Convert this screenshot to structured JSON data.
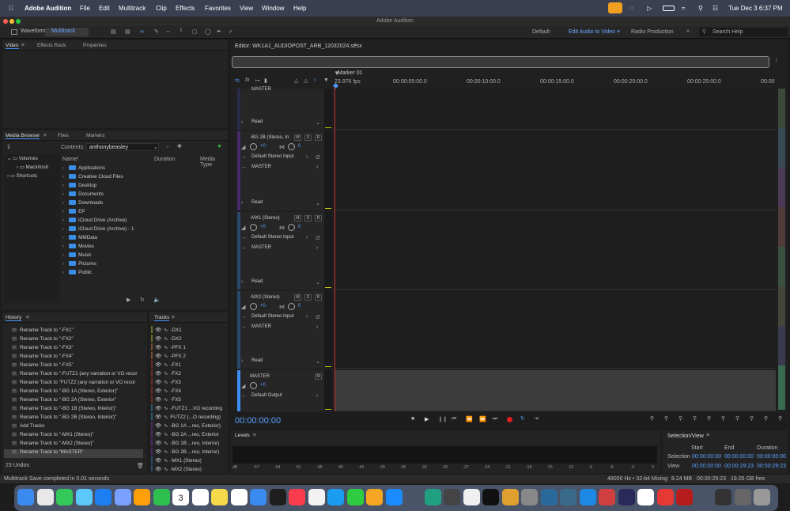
{
  "menubar": {
    "app": "Adobe Audition",
    "items": [
      "File",
      "Edit",
      "Multitrack",
      "Clip",
      "Effects",
      "Favorites",
      "View",
      "Window",
      "Help"
    ],
    "clock": "Tue Dec 3  6:37 PM"
  },
  "window": {
    "title": "Adobe Audition"
  },
  "toolbar": {
    "waveform": "Waveform",
    "multitrack": "Multitrack",
    "workspaces": [
      "Default",
      "Edit Audio to Video",
      "Radio Production"
    ],
    "search_placeholder": "Search Help"
  },
  "left_top_tabs": [
    "Video",
    "Effects Rack",
    "Properties"
  ],
  "media_browser": {
    "tabs": [
      "Media Browser",
      "Files",
      "Markers"
    ],
    "contents_label": "Contents:",
    "contents_value": "anthonybeasley",
    "tree": [
      "Volumes",
      "Macintosh",
      "Shortcuts"
    ],
    "columns": [
      "Name",
      "Duration",
      "Media Type"
    ],
    "items": [
      "Applications",
      "Creative Cloud Files",
      "Desktop",
      "Documents",
      "Downloads",
      "EP",
      "iCloud Drive (Archive)",
      "iCloud Drive (Archive) - 1",
      "MMData",
      "Movies",
      "Music",
      "Pictures",
      "Public"
    ]
  },
  "history": {
    "title": "History",
    "items": [
      "Rename Track to \"-FX1\"",
      "Rename Track to \"-FX2\"",
      "Rename Track to \"-FX3\"",
      "Rename Track to \"-FX4\"",
      "Rename Track to \"-FX5\"",
      "Rename Track to \"-FUTZ1 (any narration or VO recor",
      "Rename Track to \"FUTZ2 (any narration or VO recor",
      "Rename Track to \"-BG 1A (Stereo, Exterior)\"",
      "Rename Track to \"-BG 2A (Stereo, Exterior\"",
      "Rename Track to \"-BG 1B (Stereo, Interior)\"",
      "Rename Track to \"-BG 2B (Stereo, Interior)\"",
      "Add Tracks",
      "Rename Track to \"-MX1 (Stereo)\"",
      "Rename Track to \"-MX2 (Stereo)\"",
      "Rename Track to \"MASTER\""
    ],
    "undos": "23 Undos"
  },
  "tracks_panel": {
    "title": "Tracks",
    "items": [
      "-DX1",
      "-DX2",
      "-PFX 1",
      "-PFX 2",
      "-FX1",
      "-FX2",
      "-FX3",
      "-FX4",
      "-FX5",
      "-FUTZ1 ...VO recording",
      "FUTZ2 (...O recording)",
      "-BG 1A ...reo, Exterior)",
      "-BG 2A ...reo, Exterior",
      "-BG 1B ...reo, Interior)",
      "-BG 2B ...reo, Interior)",
      "-MX1 (Stereo)",
      "-MX2 (Stereo)"
    ]
  },
  "editor": {
    "title": "Editor: WK1A1_AUDIOPOST_ARB_12032024.sesx",
    "marker": "Marker 01",
    "fps": "23.976 fps",
    "ruler": [
      "00:00:05:00.0",
      "00:00:10:00.0",
      "00:00:15:00.0",
      "00:00:20:00.0",
      "00:00:25:00.0",
      "00:00"
    ],
    "tracks": [
      {
        "name": "MASTER",
        "read": "Read"
      },
      {
        "name": "-BG 2B (Stereo, In",
        "vol": "+0",
        "pan": "0",
        "input": "Default Stereo Input",
        "output": "MASTER",
        "read": "Read"
      },
      {
        "name": "-MX1 (Stereo)",
        "vol": "+0",
        "pan": "0",
        "input": "Default Stereo Input",
        "output": "MASTER",
        "read": "Read"
      },
      {
        "name": "-MX2 (Stereo)",
        "vol": "+0",
        "pan": "0",
        "input": "Default Stereo Input",
        "output": "MASTER",
        "read": "Read"
      },
      {
        "name": "MASTER",
        "vol": "+0",
        "output": "Default Output"
      }
    ],
    "time": "00:00:00:00"
  },
  "levels": {
    "title": "Levels",
    "scale": [
      "dB",
      "-57",
      "-54",
      "-51",
      "-48",
      "-45",
      "-42",
      "-39",
      "-36",
      "-33",
      "-30",
      "-27",
      "-24",
      "-21",
      "-18",
      "-15",
      "-12",
      "-9",
      "-6",
      "-3",
      "0"
    ]
  },
  "selection_view": {
    "title": "Selection/View",
    "cols": [
      "Start",
      "End",
      "Duration"
    ],
    "rows": [
      {
        "label": "Selection",
        "start": "00:00:00:00",
        "end": "00:00:00:00",
        "duration": "00:00:00:00"
      },
      {
        "label": "View",
        "start": "00:00:00:00",
        "end": "00:00:29:23",
        "duration": "00:00:29:23"
      }
    ]
  },
  "status": {
    "left": "Multitrack Save completed in 0.01 seconds",
    "rate": "48000 Hz • 32-bit Mixing",
    "mem": "8.24 MB",
    "dur": "00:00:29:23",
    "free": "19.05 GB free"
  },
  "dock": {
    "calendar_month": "DEC",
    "calendar_day": "3"
  },
  "colors": {
    "accent": "#3e8ef7",
    "playhead": "#c3312f",
    "record": "#e02020"
  }
}
